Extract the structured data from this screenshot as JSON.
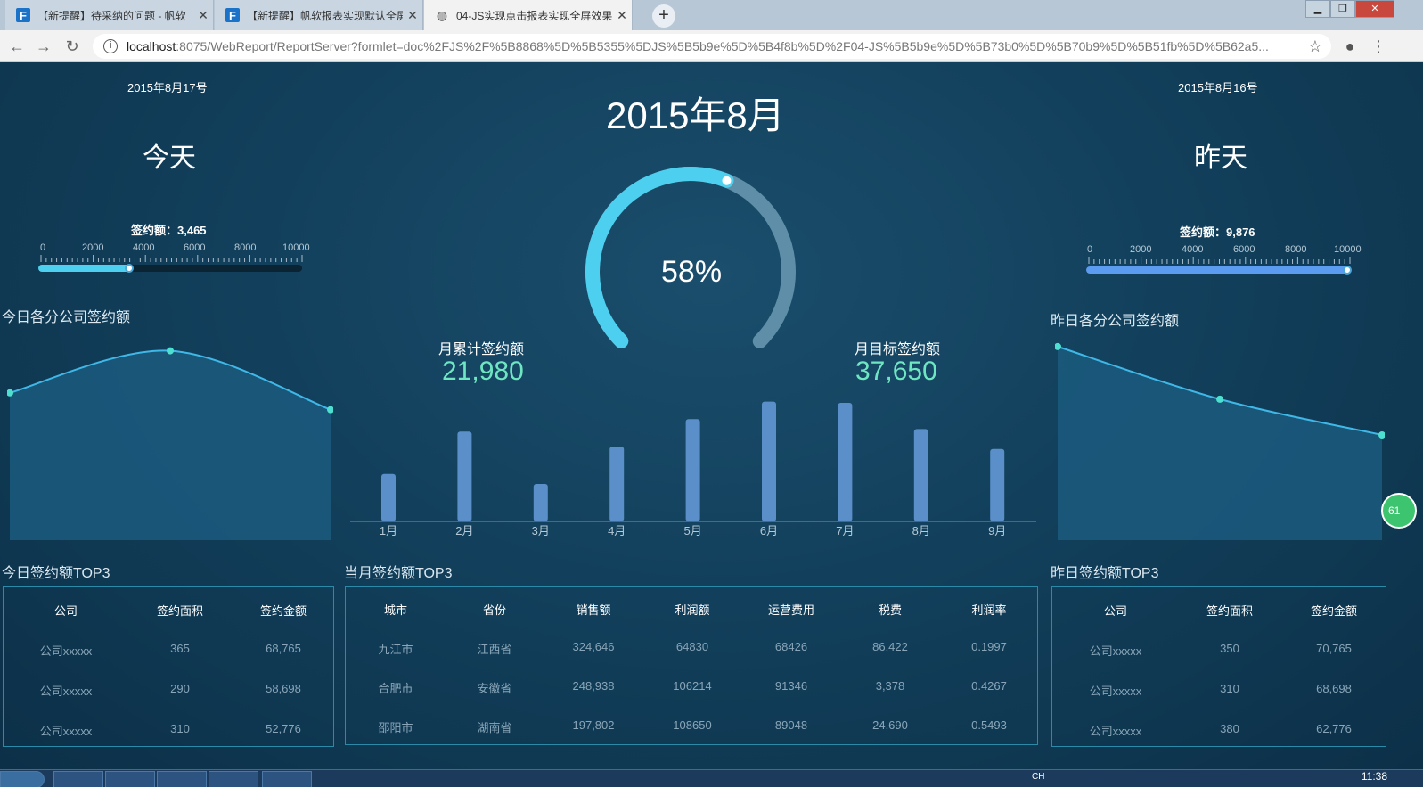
{
  "browser": {
    "tabs": [
      {
        "label": "【新提醒】待采纳的问题 - 帆软",
        "close": "✕"
      },
      {
        "label": "【新提醒】帆软报表实现默认全屏",
        "close": "✕"
      },
      {
        "label": "04-JS实现点击报表实现全屏效果",
        "close": "✕"
      }
    ],
    "new_tab": "+",
    "url_host": "localhost",
    "url_rest": ":8075/WebReport/ReportServer?formlet=doc%2FJS%2F%5B8868%5D%5B5355%5DJS%5B5b9e%5D%5B4f8b%5D%2F04-JS%5B5b9e%5D%5B73b0%5D%5B70b9%5D%5B51fb%5D%5B62a5..."
  },
  "dashboard": {
    "title": "2015年8月",
    "gauge_value": "58%",
    "gauge_fraction": 0.58,
    "today": {
      "date": "2015年8月17号",
      "label": "今天",
      "amount_text": "签约额：3,465",
      "slider_value": 3465,
      "slider_max": 10000,
      "ticks": [
        "0",
        "2000",
        "4000",
        "6000",
        "8000",
        "10000"
      ]
    },
    "yesterday": {
      "date": "2015年8月16号",
      "label": "昨天",
      "amount_text": "签约额：9,876",
      "slider_value": 9876,
      "slider_max": 10000,
      "ticks": [
        "0",
        "2000",
        "4000",
        "6000",
        "8000",
        "10000"
      ]
    },
    "today_chart_title": "今日各分公司签约额",
    "yesterday_chart_title": "昨日各分公司签约额",
    "month_cumulative_label": "月累计签约额",
    "month_cumulative_value": "21,980",
    "month_target_label": "月目标签约额",
    "month_target_value": "37,650",
    "today_top3_title": "今日签约额TOP3",
    "month_top3_title": "当月签约额TOP3",
    "yesterday_top3_title": "昨日签约额TOP3",
    "today_table": {
      "headers": [
        "公司",
        "签约面积",
        "签约金额"
      ],
      "rows": [
        [
          "公司xxxxx",
          "365",
          "68,765"
        ],
        [
          "公司xxxxx",
          "290",
          "58,698"
        ],
        [
          "公司xxxxx",
          "310",
          "52,776"
        ]
      ]
    },
    "month_table": {
      "headers": [
        "城市",
        "省份",
        "销售额",
        "利润额",
        "运营费用",
        "税费",
        "利润率"
      ],
      "rows": [
        [
          "九江市",
          "江西省",
          "324,646",
          "64830",
          "68426",
          "86,422",
          "0.1997"
        ],
        [
          "合肥市",
          "安徽省",
          "248,938",
          "106214",
          "91346",
          "3,378",
          "0.4267"
        ],
        [
          "邵阳市",
          "湖南省",
          "197,802",
          "108650",
          "89048",
          "24,690",
          "0.5493"
        ]
      ]
    },
    "yesterday_table": {
      "headers": [
        "公司",
        "签约面积",
        "签约金额"
      ],
      "rows": [
        [
          "公司xxxxx",
          "350",
          "70,765"
        ],
        [
          "公司xxxxx",
          "310",
          "68,698"
        ],
        [
          "公司xxxxx",
          "380",
          "62,776"
        ]
      ]
    },
    "side_badge": "61"
  },
  "chart_data": [
    {
      "type": "area",
      "title": "今日各分公司签约额",
      "x": [
        1,
        2,
        3
      ],
      "values": [
        70,
        90,
        62
      ],
      "ylim": [
        0,
        100
      ]
    },
    {
      "type": "bar",
      "categories": [
        "1月",
        "2月",
        "3月",
        "4月",
        "5月",
        "6月",
        "7月",
        "8月",
        "9月"
      ],
      "values": [
        38,
        72,
        30,
        60,
        82,
        96,
        95,
        74,
        58
      ],
      "ylim": [
        0,
        100
      ]
    },
    {
      "type": "area",
      "title": "昨日各分公司签约额",
      "x": [
        1,
        2,
        3
      ],
      "values": [
        92,
        67,
        50
      ],
      "ylim": [
        0,
        100
      ]
    }
  ],
  "taskbar": {
    "clock": "11:38",
    "lang": "CH"
  },
  "colors": {
    "accent": "#4dd0f0",
    "gauge_track": "#5f8fa8",
    "bar": "#5b8fc9",
    "kpi": "#6fe6c2",
    "line": "#3fb8e8"
  }
}
